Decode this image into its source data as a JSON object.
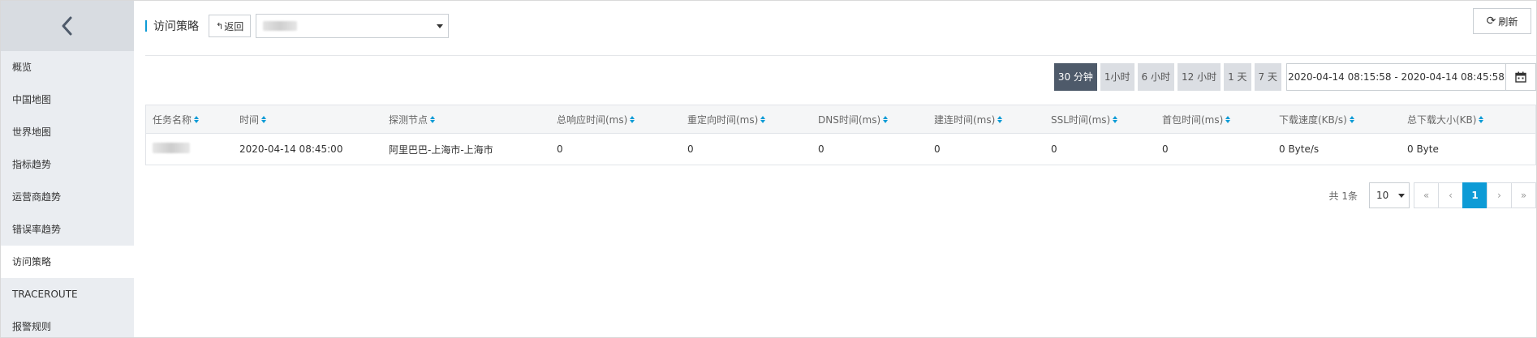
{
  "sidebar": {
    "collapse_icon": "chevron-left-icon",
    "items": [
      {
        "label": "概览"
      },
      {
        "label": "中国地图"
      },
      {
        "label": "世界地图"
      },
      {
        "label": "指标趋势"
      },
      {
        "label": "运营商趋势"
      },
      {
        "label": "错误率趋势"
      },
      {
        "label": "访问策略",
        "active": true
      },
      {
        "label": "TRACEROUTE"
      },
      {
        "label": "报警规则"
      }
    ]
  },
  "header": {
    "title": "访问策略",
    "back_label": "返回",
    "refresh_label": "刷新"
  },
  "range": {
    "options": [
      "30 分钟",
      "1小时",
      "6 小时",
      "12 小时",
      "1 天",
      "7 天"
    ],
    "selected": "30 分钟",
    "date_range": "2020-04-14 08:15:58 - 2020-04-14 08:45:58"
  },
  "table": {
    "columns": [
      "任务名称",
      "时间",
      "探测节点",
      "总响应时间(ms)",
      "重定向时间(ms)",
      "DNS时间(ms)",
      "建连时间(ms)",
      "SSL时间(ms)",
      "首包时间(ms)",
      "下载速度(KB/s)",
      "总下载大小(KB)"
    ],
    "rows": [
      [
        "",
        "2020-04-14 08:45:00",
        "阿里巴巴-上海市-上海市",
        "0",
        "0",
        "0",
        "0",
        "0",
        "0",
        "0 Byte/s",
        "0 Byte"
      ]
    ]
  },
  "pager": {
    "total": "共 1条",
    "page_size": "10",
    "first": "«",
    "prev": "‹",
    "current": "1",
    "next": "›",
    "last": "»"
  },
  "colors": {
    "accent": "#0d9bd6",
    "sidebar_bg": "#eaedf1",
    "range_active": "#4e5a6a"
  }
}
